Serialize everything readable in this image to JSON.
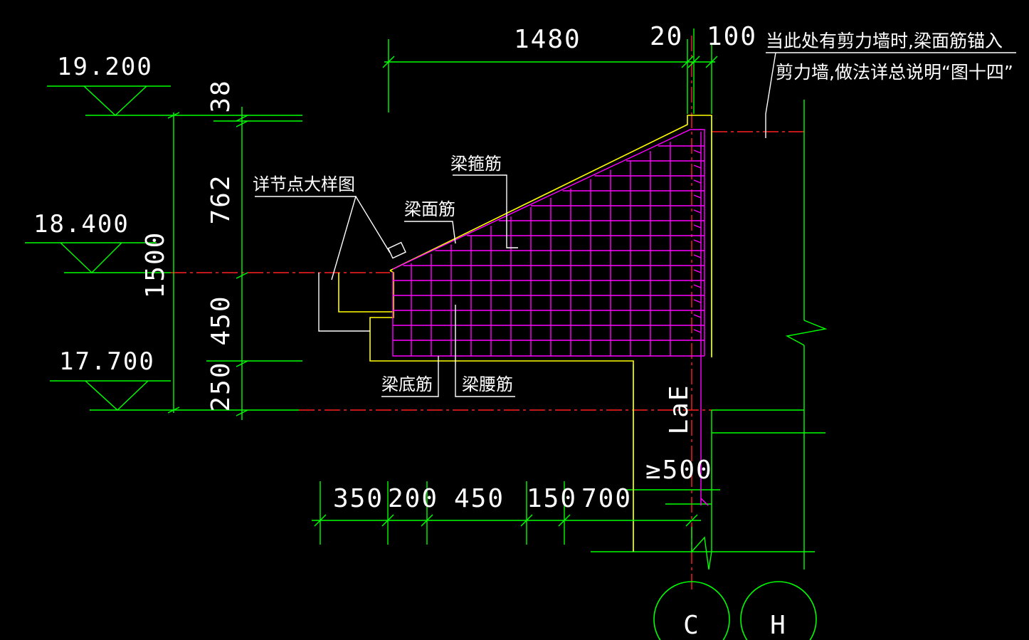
{
  "elevations": {
    "level_1": "19.200",
    "level_2": "18.400",
    "level_3": "17.700"
  },
  "dimensions_vertical": {
    "d_38": "38",
    "d_762": "762",
    "d_1500": "1500",
    "d_450": "450",
    "d_250": "250"
  },
  "dimensions_top": {
    "d_1480": "1480",
    "d_20": "20",
    "d_100": "100"
  },
  "dimensions_bottom": {
    "d_350": "350",
    "d_200": "200",
    "d_450": "450",
    "d_150": "150",
    "d_700": "700"
  },
  "anchorage": {
    "lae": "LaE",
    "min_len": "≥500"
  },
  "labels": {
    "detail": "详节点大样图",
    "stirrup": "梁箍筋",
    "top_bar": "梁面筋",
    "bottom_bar": "梁底筋",
    "waist_bar": "梁腰筋"
  },
  "note": {
    "line1": "当此处有剪力墙时,梁面筋锚入",
    "line2": "剪力墙,做法详总说明“图十四”"
  },
  "axes": {
    "axis_left": "C",
    "axis_right": "H"
  },
  "colors": {
    "background": "#000000",
    "dimension_lines": "#00ff00",
    "concrete_outline": "#ffff00",
    "rebar": "#ff00ff",
    "center_lines": "#ff2020",
    "text": "#ffffff"
  }
}
